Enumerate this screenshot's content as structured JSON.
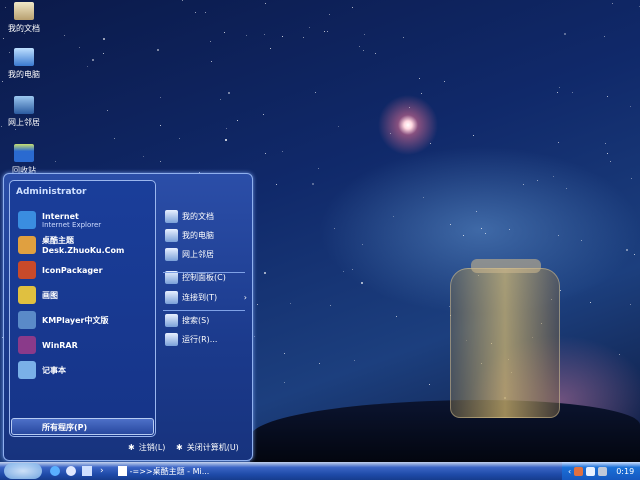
{
  "desktop": {
    "icons": [
      {
        "label": "我的文档"
      },
      {
        "label": "我的电脑"
      },
      {
        "label": "网上邻居"
      },
      {
        "label": "回收站"
      }
    ]
  },
  "start_menu": {
    "user": "Administrator",
    "programs": [
      {
        "label": "Internet",
        "sublabel": "Internet Explorer",
        "icon": "ie-icon",
        "color": "#3a8de0"
      },
      {
        "label": "桌酷主题Desk.ZhuoKu.Com",
        "icon": "zhuoku-icon",
        "color": "#e0a040"
      },
      {
        "label": "IconPackager",
        "icon": "iconpackager-icon",
        "color": "#c84a2a"
      },
      {
        "label": "画图",
        "icon": "paint-icon",
        "color": "#e0c040"
      },
      {
        "label": "KMPlayer中文版",
        "icon": "kmplayer-icon",
        "color": "#5a8ac8"
      },
      {
        "label": "WinRAR",
        "icon": "winrar-icon",
        "color": "#8a3a8a"
      },
      {
        "label": "记事本",
        "icon": "notepad-icon",
        "color": "#7ab0e8"
      }
    ],
    "all_programs": "所有程序(P)",
    "places": [
      {
        "label": "我的文档",
        "icon": "my-documents-icon"
      },
      {
        "label": "我的电脑",
        "icon": "my-computer-icon"
      },
      {
        "label": "网上邻居",
        "icon": "network-icon"
      },
      {
        "label": "控制面板(C)",
        "icon": "control-panel-icon"
      },
      {
        "label": "连接到(T)",
        "icon": "connect-icon",
        "arrow": "›"
      },
      {
        "label": "搜索(S)",
        "icon": "search-icon"
      },
      {
        "label": "运行(R)...",
        "icon": "run-icon"
      }
    ],
    "logoff": "注销(L)",
    "shutdown": "关闭计算机(U)"
  },
  "taskbar": {
    "window_label": "-=>>桌酷主题 - Mi...",
    "chevron": "›",
    "clock": "0:19",
    "tray_chevron": "‹"
  }
}
